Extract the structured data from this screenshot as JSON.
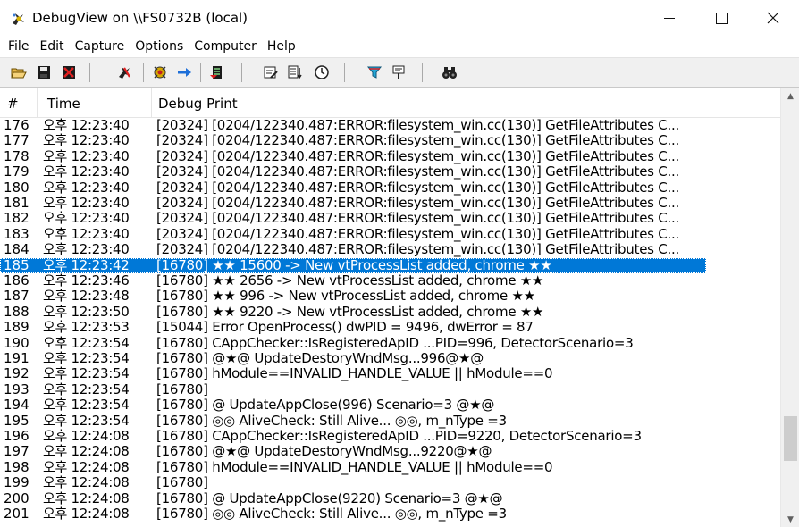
{
  "window": {
    "title": "DebugView on \\\\FS0732B (local)",
    "minimize_glyph": "—",
    "maximize_glyph": "☐",
    "close_glyph": "✕"
  },
  "menu": [
    "File",
    "Edit",
    "Capture",
    "Options",
    "Computer",
    "Help"
  ],
  "toolbar": {
    "buttons": [
      {
        "icon": "open-folder-icon"
      },
      {
        "icon": "save-icon"
      },
      {
        "icon": "clear-icon"
      },
      {
        "icon": "capture-win32-icon"
      },
      {
        "icon": "capture-kernel-icon"
      },
      {
        "icon": "pass-through-arrow-icon"
      },
      {
        "icon": "autoscroll-icon"
      },
      {
        "icon": "clock-time-icon"
      },
      {
        "icon": "show-milliseconds-icon"
      },
      {
        "icon": "timer-icon"
      },
      {
        "icon": "filter-icon"
      },
      {
        "icon": "highlight-icon"
      },
      {
        "icon": "find-binoculars-icon"
      }
    ]
  },
  "columns": {
    "num": "#",
    "time": "Time",
    "message": "Debug Print"
  },
  "colors": {
    "selection": "#0078d7",
    "toolbar_bg": "#f0f0f0"
  },
  "scrollbar": {
    "position_fraction": 0.86,
    "thumb_fraction": 0.11
  },
  "rows": [
    {
      "num": "176",
      "time": "오후 12:23:40",
      "msg": "[20324] [0204/122340.487:ERROR:filesystem_win.cc(130)] GetFileAttributes C..."
    },
    {
      "num": "177",
      "time": "오후 12:23:40",
      "msg": "[20324] [0204/122340.487:ERROR:filesystem_win.cc(130)] GetFileAttributes C..."
    },
    {
      "num": "178",
      "time": "오후 12:23:40",
      "msg": "[20324] [0204/122340.487:ERROR:filesystem_win.cc(130)] GetFileAttributes C..."
    },
    {
      "num": "179",
      "time": "오후 12:23:40",
      "msg": "[20324] [0204/122340.487:ERROR:filesystem_win.cc(130)] GetFileAttributes C..."
    },
    {
      "num": "180",
      "time": "오후 12:23:40",
      "msg": "[20324] [0204/122340.487:ERROR:filesystem_win.cc(130)] GetFileAttributes C..."
    },
    {
      "num": "181",
      "time": "오후 12:23:40",
      "msg": "[20324] [0204/122340.487:ERROR:filesystem_win.cc(130)] GetFileAttributes C..."
    },
    {
      "num": "182",
      "time": "오후 12:23:40",
      "msg": "[20324] [0204/122340.487:ERROR:filesystem_win.cc(130)] GetFileAttributes C..."
    },
    {
      "num": "183",
      "time": "오후 12:23:40",
      "msg": "[20324] [0204/122340.487:ERROR:filesystem_win.cc(130)] GetFileAttributes C..."
    },
    {
      "num": "184",
      "time": "오후 12:23:40",
      "msg": "[20324] [0204/122340.487:ERROR:filesystem_win.cc(130)] GetFileAttributes C..."
    },
    {
      "num": "185",
      "time": "오후 12:23:42",
      "msg": "[16780] ★★ 15600 -> New vtProcessList added, chrome ★★",
      "selected": true
    },
    {
      "num": "186",
      "time": "오후 12:23:46",
      "msg": "[16780] ★★ 2656 -> New vtProcessList added, chrome ★★"
    },
    {
      "num": "187",
      "time": "오후 12:23:48",
      "msg": "[16780] ★★ 996 -> New vtProcessList added, chrome ★★"
    },
    {
      "num": "188",
      "time": "오후 12:23:50",
      "msg": "[16780] ★★ 9220 -> New vtProcessList added, chrome ★★"
    },
    {
      "num": "189",
      "time": "오후 12:23:53",
      "msg": "[15044] Error OpenProcess() dwPID = 9496, dwError = 87"
    },
    {
      "num": "190",
      "time": "오후 12:23:54",
      "msg": "[16780] CAppChecker::IsRegisteredApID ...PID=996, DetectorScenario=3"
    },
    {
      "num": "191",
      "time": "오후 12:23:54",
      "msg": "[16780] @★@ UpdateDestoryWndMsg...996@★@"
    },
    {
      "num": "192",
      "time": "오후 12:23:54",
      "msg": "[16780] hModule==INVALID_HANDLE_VALUE || hModule==0"
    },
    {
      "num": "193",
      "time": "오후 12:23:54",
      "msg": "[16780]"
    },
    {
      "num": "194",
      "time": "오후 12:23:54",
      "msg": "[16780] @ UpdateAppClose(996) Scenario=3 @★@"
    },
    {
      "num": "195",
      "time": "오후 12:23:54",
      "msg": "[16780] ◎◎ AliveCheck: Still Alive... ◎◎, m_nType =3"
    },
    {
      "num": "196",
      "time": "오후 12:24:08",
      "msg": "[16780] CAppChecker::IsRegisteredApID ...PID=9220, DetectorScenario=3"
    },
    {
      "num": "197",
      "time": "오후 12:24:08",
      "msg": "[16780] @★@ UpdateDestoryWndMsg...9220@★@"
    },
    {
      "num": "198",
      "time": "오후 12:24:08",
      "msg": "[16780] hModule==INVALID_HANDLE_VALUE || hModule==0"
    },
    {
      "num": "199",
      "time": "오후 12:24:08",
      "msg": "[16780]"
    },
    {
      "num": "200",
      "time": "오후 12:24:08",
      "msg": "[16780] @ UpdateAppClose(9220) Scenario=3 @★@"
    },
    {
      "num": "201",
      "time": "오후 12:24:08",
      "msg": "[16780] ◎◎ AliveCheck: Still Alive... ◎◎, m_nType =3"
    }
  ]
}
